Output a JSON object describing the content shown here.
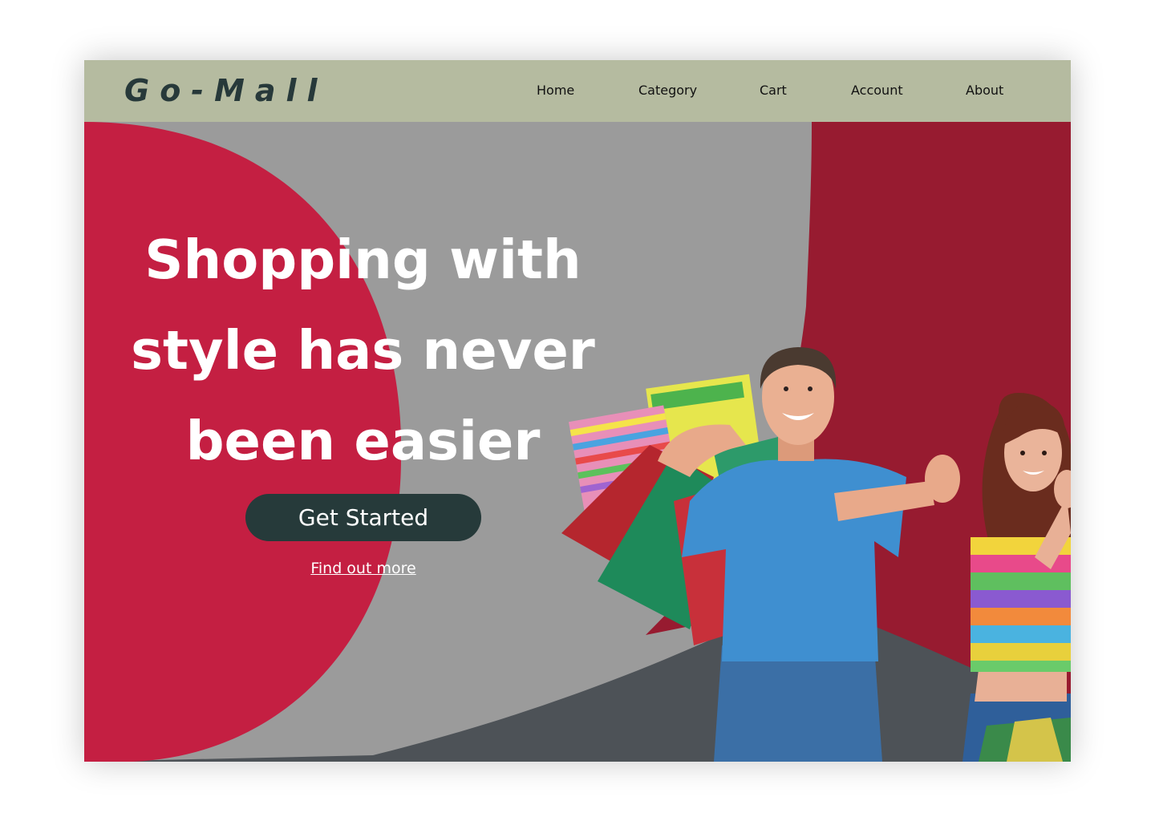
{
  "brand": {
    "logo": "Go-Mall"
  },
  "nav": {
    "items": [
      {
        "label": "Home"
      },
      {
        "label": "Category"
      },
      {
        "label": "Cart"
      },
      {
        "label": "Account"
      },
      {
        "label": "About"
      }
    ]
  },
  "hero": {
    "headline": "Shopping  with\nstyle has never\nbeen easier",
    "cta_label": "Get Started",
    "secondary_link": "Find out more",
    "image_subject": "smiling-shoppers-with-bags"
  },
  "colors": {
    "nav_bg": "#b5bba0",
    "crimson": "#c41f42",
    "deep_red": "#971b30",
    "gray": "#9b9b9b",
    "charcoal": "#4d5257",
    "button_bg": "#263a3a",
    "logo_text": "#27393a"
  }
}
